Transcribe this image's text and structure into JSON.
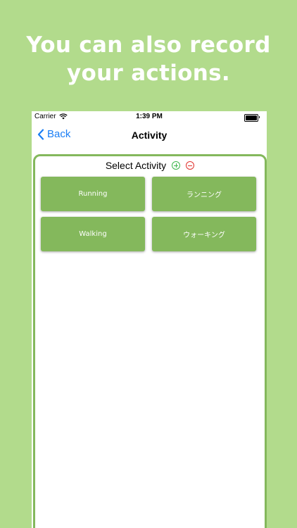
{
  "headline": {
    "line1": "You can also record",
    "line2": "your actions."
  },
  "statusbar": {
    "carrier": "Carrier",
    "time": "1:39 PM"
  },
  "navbar": {
    "back_label": "Back",
    "title": "Activity"
  },
  "card": {
    "title": "Select Activity",
    "activities": [
      {
        "label": "Running"
      },
      {
        "label": "ランニング"
      },
      {
        "label": "Walking"
      },
      {
        "label": "ウォーキング"
      }
    ]
  },
  "colors": {
    "background": "#b2db8c",
    "accent": "#84b85c",
    "link": "#1a7ef5",
    "add": "#3bb54a",
    "remove": "#e0322d"
  },
  "icons": [
    "wifi-icon",
    "battery-icon",
    "chevron-left-icon",
    "add-circle-icon",
    "remove-circle-icon"
  ]
}
